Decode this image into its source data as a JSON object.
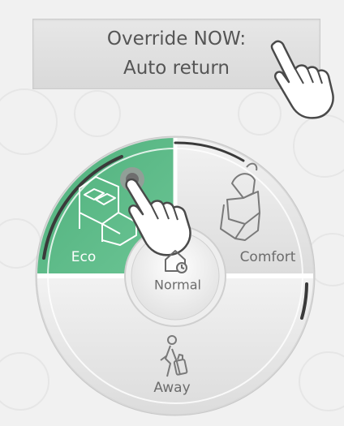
{
  "override": {
    "line1": "Override NOW:",
    "line2": "Auto return"
  },
  "dial": {
    "modes": {
      "eco": "Eco",
      "comfort": "Comfort",
      "normal": "Normal",
      "away": "Away"
    },
    "selected": "eco"
  },
  "icons": {
    "eco": "bed-icon",
    "comfort": "armchair-icon",
    "normal": "home-clock-icon",
    "away": "walking-person-suitcase-icon",
    "pointer": "pointing-hand-icon"
  },
  "colors": {
    "eco_active": "#5cb887",
    "segment_base": "#e4e4e4",
    "ring": "#d5d5d5",
    "label": "#6c6c6c"
  }
}
